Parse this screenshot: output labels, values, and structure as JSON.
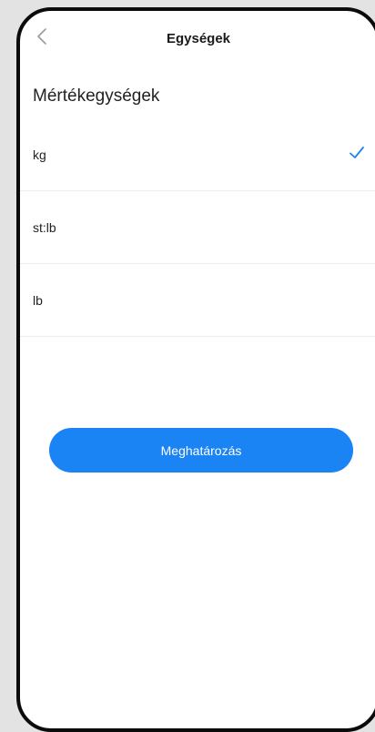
{
  "header": {
    "title": "Egységek",
    "back_icon": "chevron-left-icon"
  },
  "section_title": "Mértékegységek",
  "units": [
    {
      "label": "kg",
      "selected": true
    },
    {
      "label": "st:lb",
      "selected": false
    },
    {
      "label": "lb",
      "selected": false
    }
  ],
  "check_icon": "checkmark-icon",
  "primary_button_label": "Meghatározás",
  "colors": {
    "accent": "#1a84f5",
    "text": "#222222",
    "divider": "#ececec",
    "frame": "#0b0b0b",
    "background": "#e3e3e3"
  }
}
